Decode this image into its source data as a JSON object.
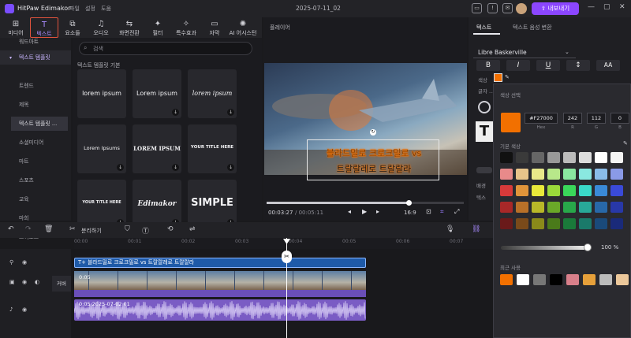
{
  "app": {
    "name": "HitPaw Edimakor",
    "menu": [
      "파일",
      "설정",
      "도움"
    ],
    "project_date": "2025-07-11_02",
    "export_label": "내보내기"
  },
  "toolbar": {
    "tools": [
      {
        "name": "media",
        "label": "미디어",
        "icon": "media-icon",
        "glyph": "⊞"
      },
      {
        "name": "text",
        "label": "텍스트",
        "icon": "text-icon",
        "glyph": "T",
        "active": true
      },
      {
        "name": "elements",
        "label": "요소들",
        "icon": "elements-icon",
        "glyph": "⧉"
      },
      {
        "name": "audio",
        "label": "오디오",
        "icon": "music-icon",
        "glyph": "♫"
      },
      {
        "name": "transition",
        "label": "화면전환",
        "icon": "transition-icon",
        "glyph": "⇆"
      },
      {
        "name": "filter",
        "label": "필터",
        "icon": "filter-icon",
        "glyph": "✦"
      },
      {
        "name": "effects",
        "label": "특수효과",
        "icon": "effects-icon",
        "glyph": "✧"
      },
      {
        "name": "subtitle",
        "label": "자막",
        "icon": "subtitle-icon",
        "glyph": "▭"
      },
      {
        "name": "ai",
        "label": "AI 어시스턴",
        "icon": "ai-icon",
        "glyph": "✺"
      }
    ]
  },
  "sidebar": {
    "items": [
      {
        "label": "워드아트",
        "active": false
      },
      {
        "label": "텍스트 템플릿",
        "active": true
      },
      {
        "label": "트렌드",
        "sub": true
      },
      {
        "label": "제목",
        "sub": true
      },
      {
        "label": "텍스트 템플릿 ...",
        "sub": true,
        "selected": true
      },
      {
        "label": "소셜미디어",
        "sub": true
      },
      {
        "label": "마트",
        "sub": true
      },
      {
        "label": "스포츠",
        "sub": true
      },
      {
        "label": "교육",
        "sub": true
      },
      {
        "label": "마희",
        "sub": true
      },
      {
        "label": "브이로그",
        "sub": true
      }
    ]
  },
  "library": {
    "search_placeholder": "검색",
    "section_title": "텍스트 템플릿 기본",
    "cards": [
      {
        "text": "lorem ipsum",
        "style": "sans"
      },
      {
        "text": "Lorem ipsum",
        "style": "sans"
      },
      {
        "text": "lorem ipsum",
        "style": "script"
      },
      {
        "text": "Lorem Ipsums",
        "style": "stack"
      },
      {
        "text": "LOREM IPSUM",
        "style": "bold"
      },
      {
        "text": "YOUR TITLE HERE",
        "style": "caps"
      },
      {
        "text": "YOUR TITLE HERE",
        "style": "caps-left"
      },
      {
        "text": "Edimakor",
        "style": "brush"
      },
      {
        "text": "SIMPLE",
        "style": "heavy"
      }
    ]
  },
  "preview": {
    "title": "플레이어",
    "overlay_line1": "블라드밀로 크로크밀로 vs",
    "overlay_line2": "트랄랄레로 트랄랄라",
    "current_time": "00:03:27",
    "total_time": "/ 00:05:11",
    "aspect": "16:9",
    "progress": 0.72
  },
  "props": {
    "tabs": [
      "텍스트",
      "텍스트 음성 변환"
    ],
    "font": "Libre Baskerville",
    "format_buttons": [
      "B",
      "I",
      "U",
      "↕",
      "AA"
    ],
    "color_label": "색상",
    "color_hex_accent": "#F27000",
    "misc_labels": [
      "글자 ...",
      "배경",
      "텍스"
    ]
  },
  "color_picker": {
    "title": "색상 선택",
    "hex": "#F27000",
    "r": "242",
    "g": "112",
    "b": "0",
    "labels": [
      "Hex",
      "R",
      "G",
      "B"
    ],
    "basic_title": "기본 색상",
    "basic_colors": [
      "#111111",
      "#3a3a3a",
      "#666666",
      "#999999",
      "#bbbbbb",
      "#dddddd",
      "#ffffff",
      "#f4f4f4",
      "#ffffff",
      "#ffffff",
      "#e88a8a",
      "#e8c48a",
      "#e8e88a",
      "#b8e88a",
      "#8ae8a0",
      "#8ae8e0",
      "#8abce8",
      "#8a9ae8",
      "#a88ae8",
      "#d88ae8",
      "#d83a3a",
      "#e0943a",
      "#e8e83a",
      "#9ad83a",
      "#3ad85a",
      "#3ad8c8",
      "#3a8ad8",
      "#3a4ad8",
      "#7a3ad8",
      "#c83ad8",
      "#a82828",
      "#b87028",
      "#b8b828",
      "#6aa828",
      "#28a84a",
      "#28a898",
      "#2868a8",
      "#2838a8",
      "#5a28a8",
      "#9828a8",
      "#6a1a1a",
      "#7a4a1a",
      "#8a8a1a",
      "#4a7a1a",
      "#1a7a3a",
      "#1a7a6a",
      "#1a4a7a",
      "#1a2a7a",
      "#3a1a7a",
      "#6a1a7a"
    ],
    "opacity": "100 %",
    "opacity_value": 1.0,
    "recent_title": "최근 사용",
    "recent_colors": [
      "#f27000",
      "#ffffff",
      "#777777",
      "#000000",
      "#d87f8a",
      "#e6a03a",
      "#bbbbbb",
      "#ebc79a"
    ]
  },
  "timeline": {
    "split_label": "분리하기",
    "ruler": [
      "00:00",
      "00:01",
      "00:02",
      "00:03",
      "00:04",
      "00:05",
      "00:06",
      "00:07"
    ],
    "title_clip": "T+ 블라드밀로 크로크밀로 vs 트랄랄레로 트랄랄라",
    "video_clip_time": "0:05",
    "audio_clip": "0:05 2025-07-02 01",
    "track_label": "커버"
  }
}
